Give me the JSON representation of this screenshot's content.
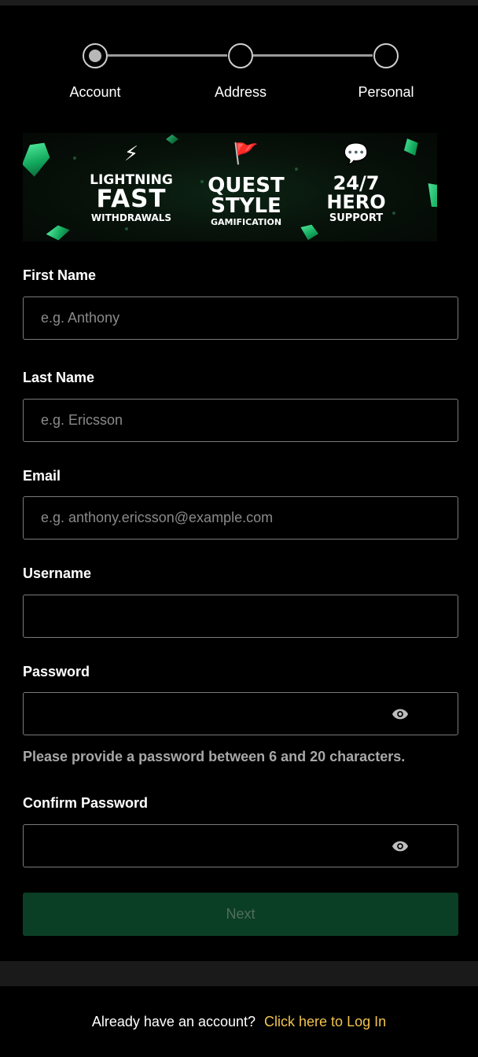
{
  "stepper": {
    "steps": [
      {
        "label": "Account",
        "active": true
      },
      {
        "label": "Address",
        "active": false
      },
      {
        "label": "Personal",
        "active": false
      }
    ]
  },
  "banner": {
    "features": [
      {
        "icon": "lightning-icon",
        "line1": "LIGHTNING",
        "line2": "FAST",
        "line3": "WITHDRAWALS"
      },
      {
        "icon": "flag-icon",
        "line1": "QUEST",
        "line2": "STYLE",
        "line3": "GAMIFICATION"
      },
      {
        "icon": "chat-bubble-icon",
        "line1": "24/7",
        "line2": "HERO",
        "line3": "SUPPORT"
      }
    ],
    "accent": "#1fd17a"
  },
  "form": {
    "first_name": {
      "label": "First Name",
      "placeholder": "e.g. Anthony",
      "value": ""
    },
    "last_name": {
      "label": "Last Name",
      "placeholder": "e.g. Ericsson",
      "value": ""
    },
    "email": {
      "label": "Email",
      "placeholder": "e.g. anthony.ericsson@example.com",
      "value": ""
    },
    "username": {
      "label": "Username",
      "placeholder": "",
      "value": ""
    },
    "password": {
      "label": "Password",
      "placeholder": "",
      "value": "",
      "hint": "Please provide a password between 6 and 20 characters."
    },
    "confirm_password": {
      "label": "Confirm Password",
      "placeholder": "",
      "value": ""
    },
    "next_label": "Next"
  },
  "footer": {
    "question": "Already have an account?",
    "login_link": "Click here to Log In"
  },
  "colors": {
    "background": "#000000",
    "button_bg": "#0b3f25",
    "link": "#f2c34e"
  }
}
